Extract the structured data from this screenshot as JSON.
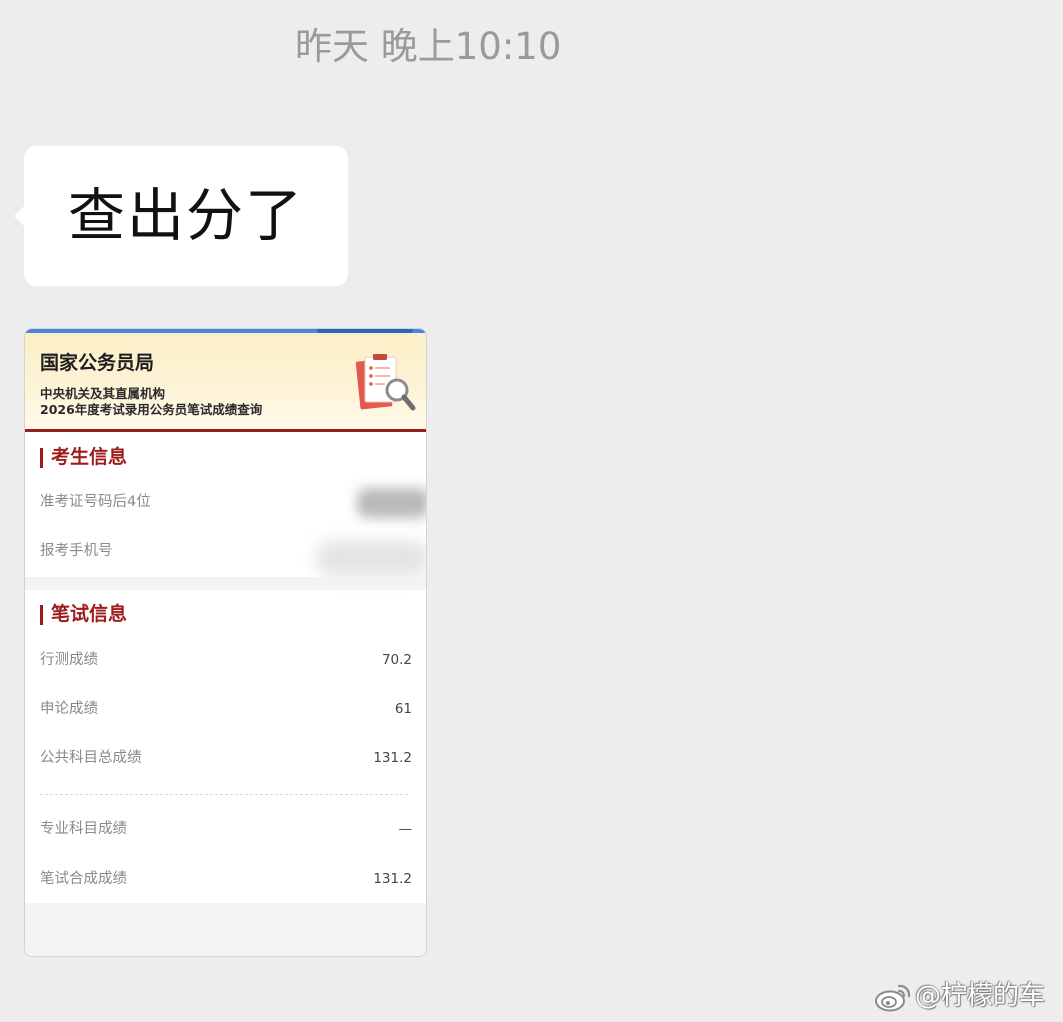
{
  "chat": {
    "timestamp": "昨天 晚上10:10",
    "message": {
      "text": "查出分了"
    },
    "image_message": {
      "header": {
        "title": "国家公务员局",
        "subtitle_line1": "中央机关及其直属机构",
        "subtitle_line2": "2026年度考试录用公务员笔试成绩查询",
        "icon": "clipboard-search-icon"
      },
      "candidate_section": {
        "heading": "考生信息",
        "rows": [
          {
            "label": "准考证号码后4位"
          },
          {
            "label": "报考手机号"
          }
        ]
      },
      "exam_section": {
        "heading": "笔试信息",
        "rows": [
          {
            "label": "行测成绩",
            "value": "70.2"
          },
          {
            "label": "申论成绩",
            "value": "61"
          },
          {
            "label": "公共科目总成绩",
            "value": "131.2"
          },
          {
            "label": "专业科目成绩",
            "value": "—"
          },
          {
            "label": "笔试合成成绩",
            "value": "131.2"
          }
        ]
      }
    }
  },
  "watermark": {
    "text": "@柠檬的车",
    "icon": "weibo-icon"
  },
  "colors": {
    "background": "#ededed",
    "bubble": "#ffffff",
    "accent_red": "#9e1b1b",
    "header_yellow": "#fbefc6",
    "top_blue": "#4d84de"
  }
}
